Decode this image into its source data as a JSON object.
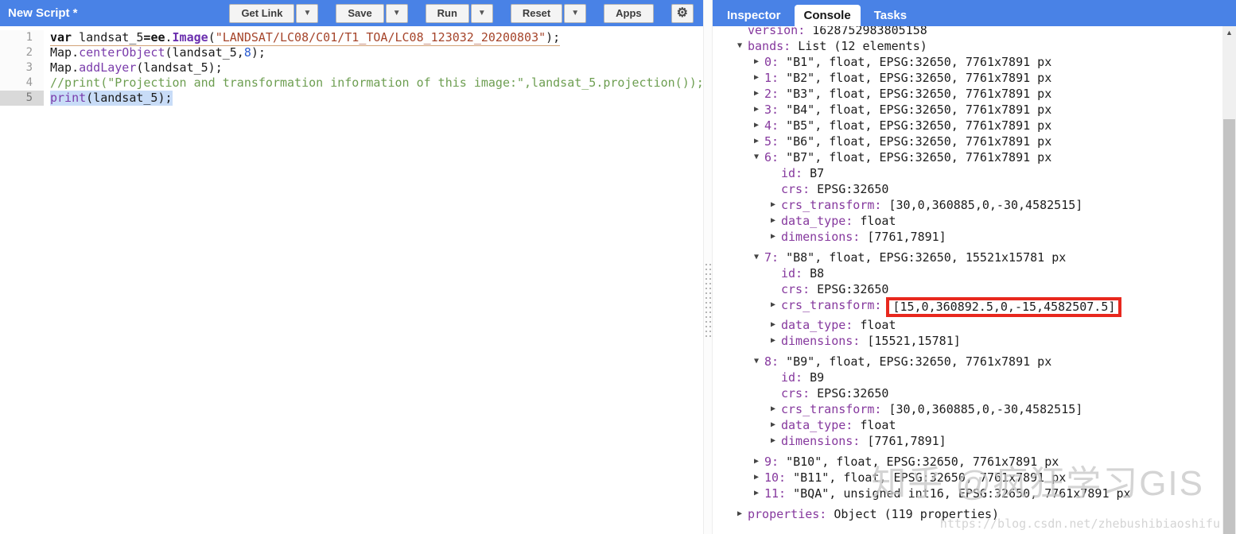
{
  "colors": {
    "header_blue": "#4982e6",
    "highlight_red": "#e8281e",
    "selection_blue": "#c8dcf7",
    "key_purple": "#86399e",
    "comment_green": "#6d9e51",
    "string_red": "#a5442a"
  },
  "editor": {
    "title": "New Script *",
    "toolbar": {
      "get_link": "Get Link",
      "save": "Save",
      "run": "Run",
      "reset": "Reset",
      "apps": "Apps",
      "dropdown_glyph": "▼",
      "gear_glyph": "⚙"
    },
    "code_lines": [
      {
        "number": "1",
        "underline": true,
        "tokens": [
          {
            "c": "kw",
            "s": "var"
          },
          {
            "c": "plain",
            "s": " landsat_5"
          },
          {
            "c": "op",
            "s": "="
          },
          {
            "c": "kw2",
            "s": "ee"
          },
          {
            "c": "plain",
            "s": "."
          },
          {
            "c": "cls",
            "s": "Image"
          },
          {
            "c": "plain",
            "s": "("
          },
          {
            "c": "str",
            "s": "\"LANDSAT/LC08/C01/T1_TOA/LC08_123032_20200803\""
          },
          {
            "c": "plain",
            "s": ");"
          }
        ]
      },
      {
        "number": "2",
        "tokens": [
          {
            "c": "plain",
            "s": "Map."
          },
          {
            "c": "meth",
            "s": "centerObject"
          },
          {
            "c": "plain",
            "s": "(landsat_5,"
          },
          {
            "c": "num",
            "s": "8"
          },
          {
            "c": "plain",
            "s": ");"
          }
        ]
      },
      {
        "number": "3",
        "tokens": [
          {
            "c": "plain",
            "s": "Map."
          },
          {
            "c": "meth",
            "s": "addLayer"
          },
          {
            "c": "plain",
            "s": "(landsat_5);"
          }
        ]
      },
      {
        "number": "4",
        "tokens": [
          {
            "c": "comment",
            "s": "//print(\"Projection and transformation information of this image:\",landsat_5.projection());"
          }
        ]
      },
      {
        "number": "5",
        "active": true,
        "selected": true,
        "tokens": [
          {
            "c": "meth",
            "s": "print"
          },
          {
            "c": "plain",
            "s": "(landsat_5);"
          }
        ]
      }
    ]
  },
  "console": {
    "tabs": [
      {
        "label": "Inspector",
        "active": false
      },
      {
        "label": "Console",
        "active": true
      },
      {
        "label": "Tasks",
        "active": false
      }
    ],
    "rows": [
      {
        "indent": 0,
        "arrow": "",
        "key": "version:",
        "value": " 1628752983805158",
        "clipped": true
      },
      {
        "indent": 0,
        "arrow": "v",
        "key": "bands:",
        "value": " List (12 elements)"
      },
      {
        "indent": 1,
        "arrow": "r",
        "key": "0:",
        "value": " \"B1\", float, EPSG:32650, 7761x7891 px"
      },
      {
        "indent": 1,
        "arrow": "r",
        "key": "1:",
        "value": " \"B2\", float, EPSG:32650, 7761x7891 px"
      },
      {
        "indent": 1,
        "arrow": "r",
        "key": "2:",
        "value": " \"B3\", float, EPSG:32650, 7761x7891 px"
      },
      {
        "indent": 1,
        "arrow": "r",
        "key": "3:",
        "value": " \"B4\", float, EPSG:32650, 7761x7891 px"
      },
      {
        "indent": 1,
        "arrow": "r",
        "key": "4:",
        "value": " \"B5\", float, EPSG:32650, 7761x7891 px"
      },
      {
        "indent": 1,
        "arrow": "r",
        "key": "5:",
        "value": " \"B6\", float, EPSG:32650, 7761x7891 px"
      },
      {
        "indent": 1,
        "arrow": "v",
        "key": "6:",
        "value": " \"B7\", float, EPSG:32650, 7761x7891 px"
      },
      {
        "indent": 2,
        "arrow": "",
        "key": "id:",
        "value": " B7"
      },
      {
        "indent": 2,
        "arrow": "",
        "key": "crs:",
        "value": " EPSG:32650"
      },
      {
        "indent": 2,
        "arrow": "r",
        "key": "crs_transform:",
        "value": " [30,0,360885,0,-30,4582515]"
      },
      {
        "indent": 2,
        "arrow": "r",
        "key": "data_type:",
        "value": " float"
      },
      {
        "indent": 2,
        "arrow": "r",
        "key": "dimensions:",
        "value": " [7761,7891]"
      },
      {
        "indent": 1,
        "arrow": "v",
        "key": "7:",
        "value": " \"B8\", float, EPSG:32650, 15521x15781 px",
        "gap": true
      },
      {
        "indent": 2,
        "arrow": "",
        "key": "id:",
        "value": " B8"
      },
      {
        "indent": 2,
        "arrow": "",
        "key": "crs:",
        "value": " EPSG:32650"
      },
      {
        "indent": 2,
        "arrow": "r",
        "key": "crs_transform:",
        "value": "[15,0,360892.5,0,-15,4582507.5]",
        "boxed": true
      },
      {
        "indent": 2,
        "arrow": "r",
        "key": "data_type:",
        "value": " float"
      },
      {
        "indent": 2,
        "arrow": "r",
        "key": "dimensions:",
        "value": " [15521,15781]"
      },
      {
        "indent": 1,
        "arrow": "v",
        "key": "8:",
        "value": " \"B9\", float, EPSG:32650, 7761x7891 px",
        "gap": true
      },
      {
        "indent": 2,
        "arrow": "",
        "key": "id:",
        "value": " B9"
      },
      {
        "indent": 2,
        "arrow": "",
        "key": "crs:",
        "value": " EPSG:32650"
      },
      {
        "indent": 2,
        "arrow": "r",
        "key": "crs_transform:",
        "value": " [30,0,360885,0,-30,4582515]"
      },
      {
        "indent": 2,
        "arrow": "r",
        "key": "data_type:",
        "value": " float"
      },
      {
        "indent": 2,
        "arrow": "r",
        "key": "dimensions:",
        "value": " [7761,7891]"
      },
      {
        "indent": 1,
        "arrow": "r",
        "key": "9:",
        "value": " \"B10\", float, EPSG:32650, 7761x7891 px",
        "gap": true
      },
      {
        "indent": 1,
        "arrow": "r",
        "key": "10:",
        "value": " \"B11\", float, EPSG:32650, 7761x7891 px"
      },
      {
        "indent": 1,
        "arrow": "r",
        "key": "11:",
        "value": " \"BQA\", unsigned int16, EPSG:32650, 7761x7891 px"
      },
      {
        "indent": 0,
        "arrow": "r",
        "key": "properties:",
        "value": " Object (119 properties)",
        "gap": true
      }
    ],
    "expand_glyphs": {
      "v": "▼",
      "r": "▶"
    },
    "scrollbar_up_glyph": "▲"
  },
  "watermark": {
    "line1": "知乎 @疯狂学习GIS",
    "url": "https://blog.csdn.net/zhebushibiaoshifu"
  }
}
